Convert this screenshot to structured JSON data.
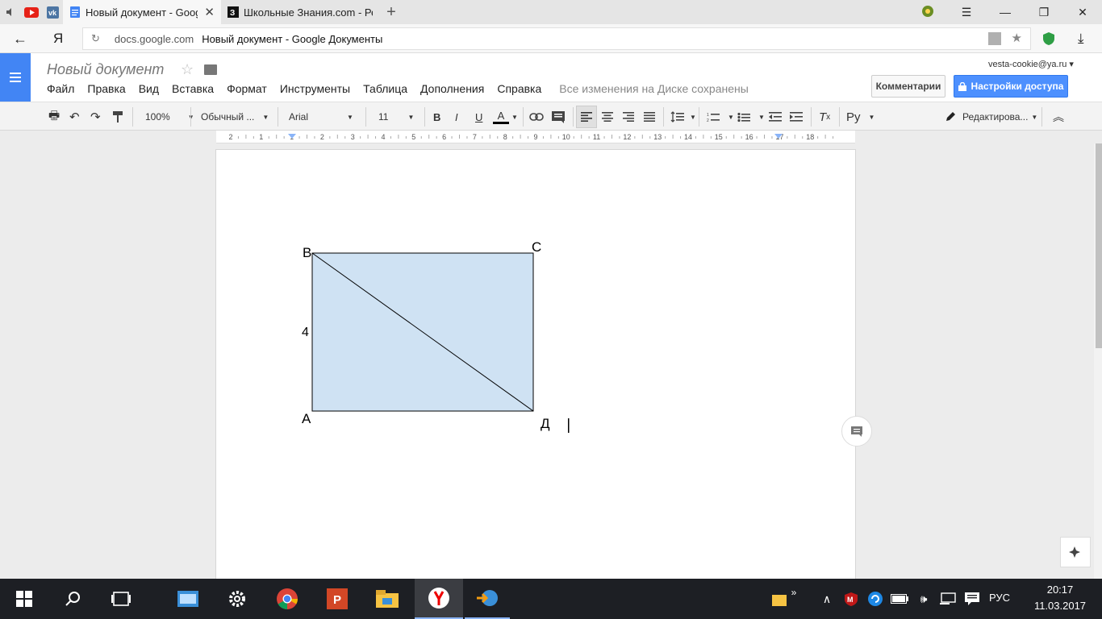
{
  "browser": {
    "tabs": [
      {
        "title": "Новый документ - Google Документы",
        "active": true
      },
      {
        "title": "Школьные Знания.com - Решение задач",
        "active": false
      }
    ],
    "address_domain": "docs.google.com",
    "address_title": "Новый документ - Google Документы",
    "yandex_label": "Я"
  },
  "docs": {
    "title": "Новый документ",
    "menus": [
      "Файл",
      "Правка",
      "Вид",
      "Вставка",
      "Формат",
      "Инструменты",
      "Таблица",
      "Дополнения",
      "Справка"
    ],
    "save_status": "Все изменения на Диске сохранены",
    "user_email": "vesta-cookie@ya.ru",
    "comments_button": "Комментарии",
    "share_button": "Настройки доступа"
  },
  "toolbar": {
    "zoom": "100%",
    "style": "Обычный ...",
    "font": "Arial",
    "size": "11",
    "bold": "B",
    "italic": "I",
    "underline": "U",
    "text_color": "A",
    "input_tools": "Ру",
    "mode": "Редактирова..."
  },
  "ruler": {
    "labels": [
      "2",
      "1",
      "1",
      "2",
      "3",
      "4",
      "5",
      "6",
      "7",
      "8",
      "9",
      "10",
      "11",
      "12",
      "13",
      "14",
      "15",
      "16",
      "17",
      "18"
    ]
  },
  "drawing": {
    "labels": {
      "b": "B",
      "c": "C",
      "a": "A",
      "d": "Д",
      "side": "4"
    },
    "fill": "#cfe2f3"
  },
  "taskbar": {
    "lang": "РУС",
    "time": "20:17",
    "date": "11.03.2017"
  }
}
